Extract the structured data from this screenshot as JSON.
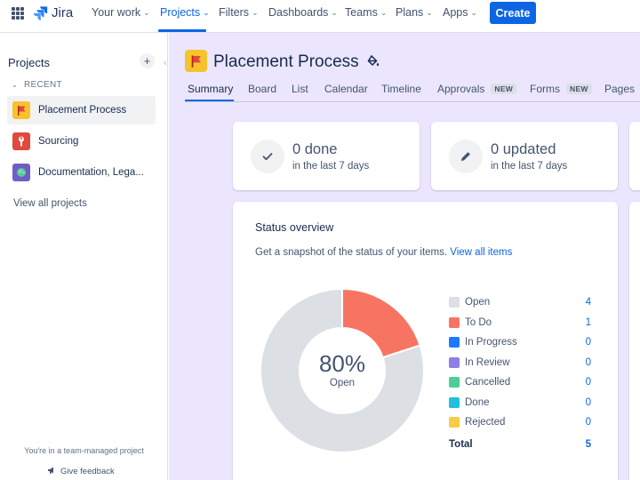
{
  "topnav": {
    "app_name": "Jira",
    "items": [
      {
        "label": "Your work"
      },
      {
        "label": "Projects"
      },
      {
        "label": "Filters"
      },
      {
        "label": "Dashboards"
      },
      {
        "label": "Teams"
      },
      {
        "label": "Plans"
      },
      {
        "label": "Apps"
      }
    ],
    "active_item": "Projects",
    "create_label": "Create",
    "accent": "#0c66e4"
  },
  "sidebar": {
    "title": "Projects",
    "add_symbol": "+",
    "recent_label": "RECENT",
    "projects": [
      {
        "label": "Placement Process",
        "icon": "red-flag-icon",
        "color": "#f8c22d"
      },
      {
        "label": "Sourcing",
        "icon": "wrench-icon",
        "color": "#e2483d"
      },
      {
        "label": "Documentation, Lega...",
        "icon": "parrot-icon",
        "color": "#6e5dc6"
      }
    ],
    "view_all": "View all projects",
    "footer_note": "You're in a team-managed project",
    "feedback": "Give feedback"
  },
  "project": {
    "title": "Placement Process",
    "tabs": [
      {
        "label": "Summary",
        "badge": ""
      },
      {
        "label": "Board",
        "badge": ""
      },
      {
        "label": "List",
        "badge": ""
      },
      {
        "label": "Calendar",
        "badge": ""
      },
      {
        "label": "Timeline",
        "badge": ""
      },
      {
        "label": "Approvals",
        "badge": "NEW"
      },
      {
        "label": "Forms",
        "badge": "NEW"
      },
      {
        "label": "Pages",
        "badge": ""
      }
    ],
    "active_tab": "Summary"
  },
  "stats": [
    {
      "value": "0 done",
      "period": "in the last 7 days",
      "icon": "check-icon"
    },
    {
      "value": "0 updated",
      "period": "in the last 7 days",
      "icon": "pencil-icon"
    }
  ],
  "status_overview": {
    "title": "Status overview",
    "description": "Get a snapshot of the status of your items.",
    "link": "View all items",
    "center_value": "80%",
    "center_label": "Open",
    "total_label": "Total",
    "total_value": "5"
  },
  "chart_data": {
    "type": "pie",
    "variant": "donut",
    "categories": [
      "Open",
      "To Do",
      "In Progress",
      "In Review",
      "Cancelled",
      "Done",
      "Rejected"
    ],
    "values": [
      4,
      1,
      0,
      0,
      0,
      0,
      0
    ],
    "colors": [
      "#dcdfe4",
      "#f87462",
      "#1d7afc",
      "#8f7ee7",
      "#4bce97",
      "#1fc1dd",
      "#f5cd47"
    ],
    "legend": "right"
  }
}
